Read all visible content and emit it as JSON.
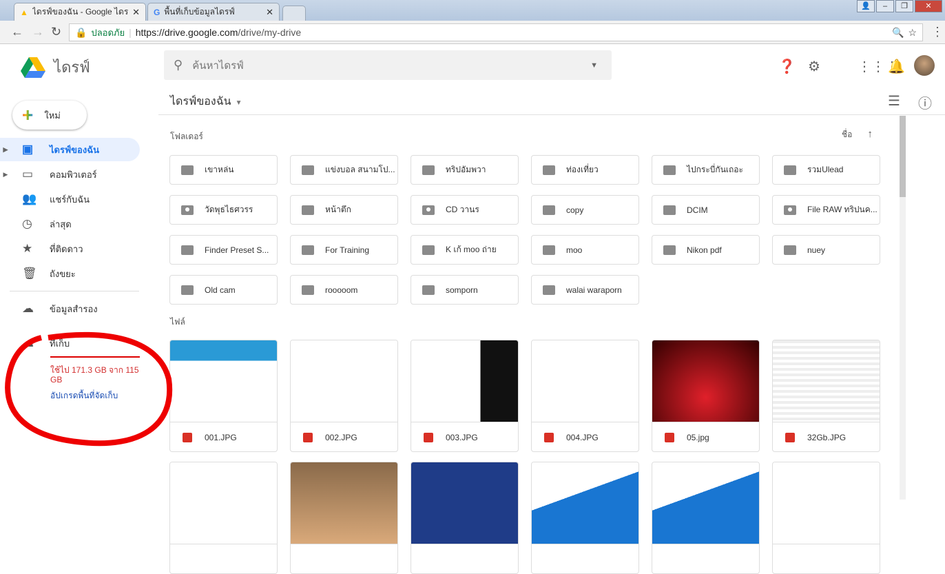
{
  "browser": {
    "tabs": [
      {
        "title": "ไดรฟ์ของฉัน - Google ไดรฟ์"
      },
      {
        "title": "พื้นที่เก็บข้อมูลไดรฟ์"
      }
    ],
    "secure_label": "ปลอดภัย",
    "url_host": "https://drive.google.com",
    "url_path": "/drive/my-drive"
  },
  "header": {
    "app_name": "ไดรฟ์",
    "search_placeholder": "ค้นหาไดรฟ์"
  },
  "sidebar": {
    "new_label": "ใหม่",
    "items": [
      {
        "label": "ไดรฟ์ของฉัน"
      },
      {
        "label": "คอมพิวเตอร์"
      },
      {
        "label": "แชร์กับฉัน"
      },
      {
        "label": "ล่าสุด"
      },
      {
        "label": "ที่ติดดาว"
      },
      {
        "label": "ถังขยะ"
      },
      {
        "label": "ข้อมูลสำรอง"
      },
      {
        "label": "ที่เก็บ"
      }
    ],
    "storage_text": "ใช้ไป 171.3 GB จาก 115 GB",
    "storage_fraction": 1.0,
    "upgrade_label": "อัปเกรดพื้นที่จัดเก็บ"
  },
  "main": {
    "title": "ไดรฟ์ของฉัน",
    "folders_label": "โฟลเดอร์",
    "files_label": "ไฟล์",
    "sort_label": "ชื่อ",
    "folders": [
      {
        "name": "เขาหล่น"
      },
      {
        "name": "แข่งบอล สนามโป..."
      },
      {
        "name": "ทริปอัมพวา"
      },
      {
        "name": "ท่องเที่ยว"
      },
      {
        "name": "ไปกระบี่กันเถอะ"
      },
      {
        "name": "รวมUlead"
      },
      {
        "name": "วัดพุธไธศวรร",
        "shared": true
      },
      {
        "name": "หน้าตึก"
      },
      {
        "name": "CD วานร",
        "shared": true
      },
      {
        "name": "copy"
      },
      {
        "name": "DCIM"
      },
      {
        "name": "File RAW ทริปนค...",
        "shared": true
      },
      {
        "name": "Finder Preset S..."
      },
      {
        "name": "For Training"
      },
      {
        "name": "K เก้ moo ถ่าย"
      },
      {
        "name": "moo"
      },
      {
        "name": "Nikon pdf"
      },
      {
        "name": "nuey"
      },
      {
        "name": "Old cam"
      },
      {
        "name": "rooooom"
      },
      {
        "name": "somporn"
      },
      {
        "name": "walai waraporn"
      }
    ],
    "files": [
      {
        "name": "001.JPG"
      },
      {
        "name": "002.JPG"
      },
      {
        "name": "003.JPG"
      },
      {
        "name": "004.JPG"
      },
      {
        "name": "05.jpg"
      },
      {
        "name": "32Gb.JPG"
      }
    ]
  }
}
